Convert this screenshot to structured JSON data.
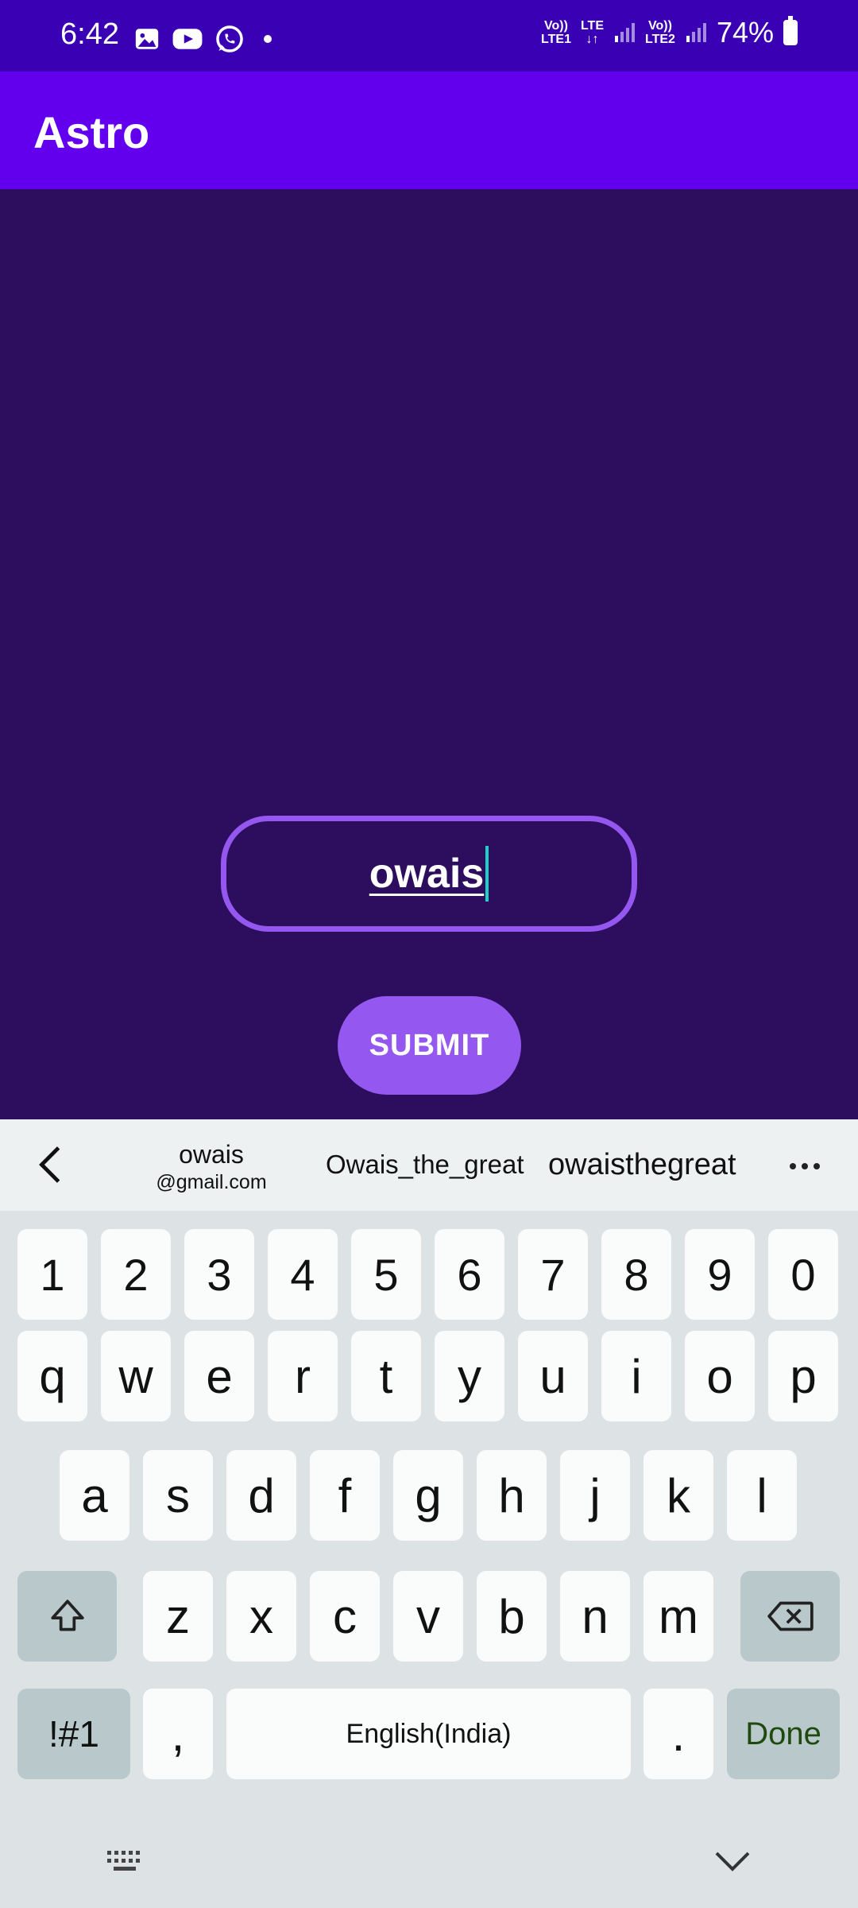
{
  "status_bar": {
    "time": "6:42",
    "net1_top": "Vo))",
    "net1_bottom": "LTE1",
    "net_lte_top": "LTE",
    "net_lte_bottom": "↓↑",
    "net2_top": "Vo))",
    "net2_bottom": "LTE2",
    "battery": "74%",
    "icons": [
      "gallery-icon",
      "youtube-icon",
      "whatsapp-icon"
    ]
  },
  "app_bar": {
    "title": "Astro"
  },
  "form": {
    "input_value": "owais",
    "submit_label": "SUBMIT"
  },
  "keyboard": {
    "suggestions": {
      "first_line1": "owais",
      "first_line2": "@gmail.com",
      "second": "Owais_the_great",
      "third": "owaisthegreat"
    },
    "number_row": [
      "1",
      "2",
      "3",
      "4",
      "5",
      "6",
      "7",
      "8",
      "9",
      "0"
    ],
    "row1": [
      "q",
      "w",
      "e",
      "r",
      "t",
      "y",
      "u",
      "i",
      "o",
      "p"
    ],
    "row2": [
      "a",
      "s",
      "d",
      "f",
      "g",
      "h",
      "j",
      "k",
      "l"
    ],
    "row3": [
      "z",
      "x",
      "c",
      "v",
      "b",
      "n",
      "m"
    ],
    "symbols_label": "!#1",
    "comma_label": ",",
    "space_label": "English(India)",
    "period_label": ".",
    "done_label": "Done"
  },
  "colors": {
    "status_bar": "#3a00b3",
    "app_bar": "#6200ee",
    "background": "#2d0e5e",
    "accent": "#9457ef"
  }
}
